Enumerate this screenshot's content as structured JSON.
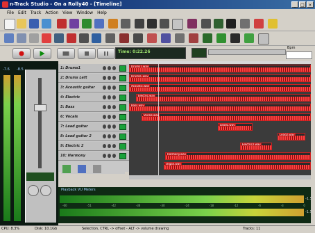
{
  "window": {
    "title": "n-Track Studio - On a Rolly40 - [Timeline]"
  },
  "menu": [
    "File",
    "Edit",
    "Track",
    "Action",
    "View",
    "Window",
    "Help"
  ],
  "transport": {
    "time": "Time: 0:22.26"
  },
  "left_meters": {
    "l": "-7.6",
    "r": "-8.5"
  },
  "tracks": [
    {
      "num": "1",
      "name": "1: Drums1",
      "clip": "Drums1.wav"
    },
    {
      "num": "2",
      "name": "2: Drums Left",
      "clip": "DrumsL.wav"
    },
    {
      "num": "3",
      "name": "3: Acoustic guitar",
      "clip": "Acoustic.wav"
    },
    {
      "num": "4",
      "name": "4: Electric",
      "clip": "Electric.wav"
    },
    {
      "num": "5",
      "name": "5: Bass",
      "clip": "Bass.wav"
    },
    {
      "num": "6",
      "name": "6: Vocals",
      "clip": "Vocals.wav"
    },
    {
      "num": "7",
      "name": "7: Lead guitar",
      "clip": "Lead1.wav"
    },
    {
      "num": "8",
      "name": "8: Lead guitar 2",
      "clip": "Lead2.wav"
    },
    {
      "num": "9",
      "name": "9: Electric 2",
      "clip": "Electric2.wav"
    },
    {
      "num": "10",
      "name": "10: Harmony",
      "clip": "Harmony.wav"
    }
  ],
  "harmony_clip2": "Organ.wav",
  "vu": {
    "title": "Playback VU Meters",
    "scale": [
      "-60",
      "-51",
      "-42",
      "-36",
      "-30",
      "-24",
      "-18",
      "-12",
      "-6",
      "-3",
      "0"
    ],
    "left_value": "-1.5",
    "right_value": "-1.5"
  },
  "status": {
    "cpu": "CPU: 8.3%",
    "disk": "Disk: 10.1Gb",
    "hint": "Selection, CTRL -> offset - ALT -> volume drawing",
    "tracks": "Tracks: 11"
  },
  "bpm_label": "Bpm",
  "colors": {
    "clip_wave": "#ff4040",
    "clip_border": "#d02020",
    "vu_green": "#1a7a1a"
  }
}
